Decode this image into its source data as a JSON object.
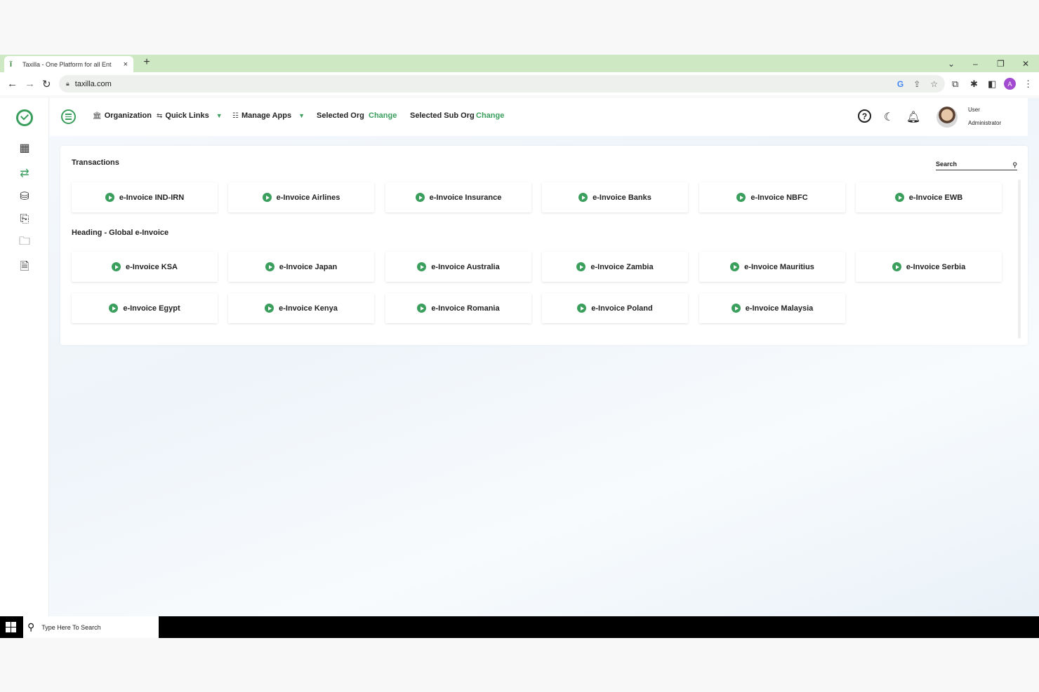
{
  "browser": {
    "tab_title": "Taxilla - One Platform for all Ent",
    "tab_close": "×",
    "new_tab": "+",
    "url": "taxilla.com",
    "window_controls": [
      "⌄",
      "–",
      "❐",
      "✕"
    ],
    "profile_initial": "A"
  },
  "header": {
    "organization": "Organization",
    "quick_links": "Quick Links",
    "manage_apps": "Manage Apps",
    "selected_org": "Selected Org",
    "selected_org_change": "Change",
    "selected_sub_org": "Selected Sub Org",
    "selected_sub_org_change": "Change",
    "user_name": "User",
    "user_role": "Administrator"
  },
  "main": {
    "transactions_title": "Transactions",
    "search_placeholder": "Search",
    "transactions": [
      "e-Invoice IND-IRN",
      "e-Invoice Airlines",
      "e-Invoice Insurance",
      "e-Invoice Banks",
      "e-Invoice NBFC",
      "e-Invoice EWB"
    ],
    "global_title": "Heading - Global e-Invoice",
    "global_row1": [
      "e-Invoice KSA",
      "e-Invoice Japan",
      "e-Invoice Australia",
      "e-Invoice Zambia",
      "e-Invoice Mauritius",
      "e-Invoice Serbia"
    ],
    "global_row2": [
      "e-Invoice Egypt",
      "e-Invoice Kenya",
      "e-Invoice Romania",
      "e-Invoice Poland",
      "e-Invoice Malaysia"
    ]
  },
  "taskbar": {
    "search_text": "Type Here To Search"
  },
  "colors": {
    "accent": "#3a9e5c",
    "tabstrip": "#cde8c3"
  }
}
